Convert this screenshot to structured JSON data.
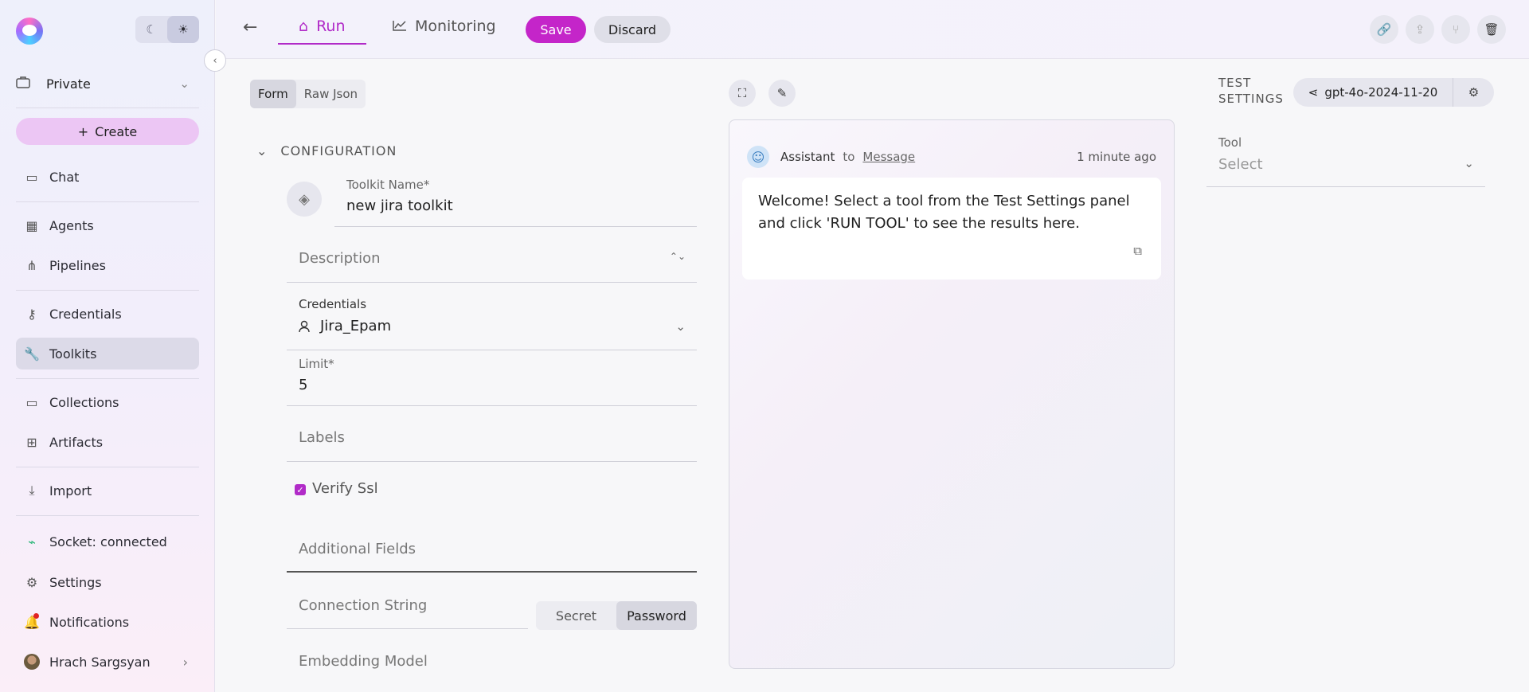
{
  "sidebar": {
    "project": "Private",
    "create": "Create",
    "items": {
      "chat": "Chat",
      "agents": "Agents",
      "pipelines": "Pipelines",
      "credentials": "Credentials",
      "toolkits": "Toolkits",
      "collections": "Collections",
      "artifacts": "Artifacts",
      "import": "Import",
      "socket": "Socket: connected",
      "settings": "Settings",
      "notifications": "Notifications",
      "user": "Hrach Sargsyan"
    }
  },
  "topbar": {
    "tab_run": "Run",
    "tab_monitoring": "Monitoring",
    "save": "Save",
    "discard": "Discard"
  },
  "form": {
    "view_form": "Form",
    "view_raw": "Raw Json",
    "section": "CONFIGURATION",
    "toolkit_name_label": "Toolkit Name*",
    "toolkit_name_value": "new jira toolkit",
    "description_placeholder": "Description",
    "credentials_label": "Credentials",
    "credentials_value": "Jira_Epam",
    "limit_label": "Limit*",
    "limit_value": "5",
    "labels_placeholder": "Labels",
    "verify_ssl": "Verify Ssl",
    "additional_fields": "Additional Fields",
    "connection_string": "Connection String",
    "secret": "Secret",
    "password": "Password",
    "embedding_model": "Embedding Model"
  },
  "chat": {
    "sender": "Assistant",
    "to": "to",
    "target": "Message",
    "time": "1 minute ago",
    "message": "Welcome! Select a tool from the Test Settings panel and click 'RUN TOOL' to see the results here."
  },
  "test_settings": {
    "title_line1": "TEST",
    "title_line2": "SETTINGS",
    "model": "gpt-4o-2024-11-20",
    "tool_label": "Tool",
    "tool_placeholder": "Select"
  },
  "colors": {
    "accent": "#c425c9",
    "accent_tab": "#b12bc8"
  }
}
